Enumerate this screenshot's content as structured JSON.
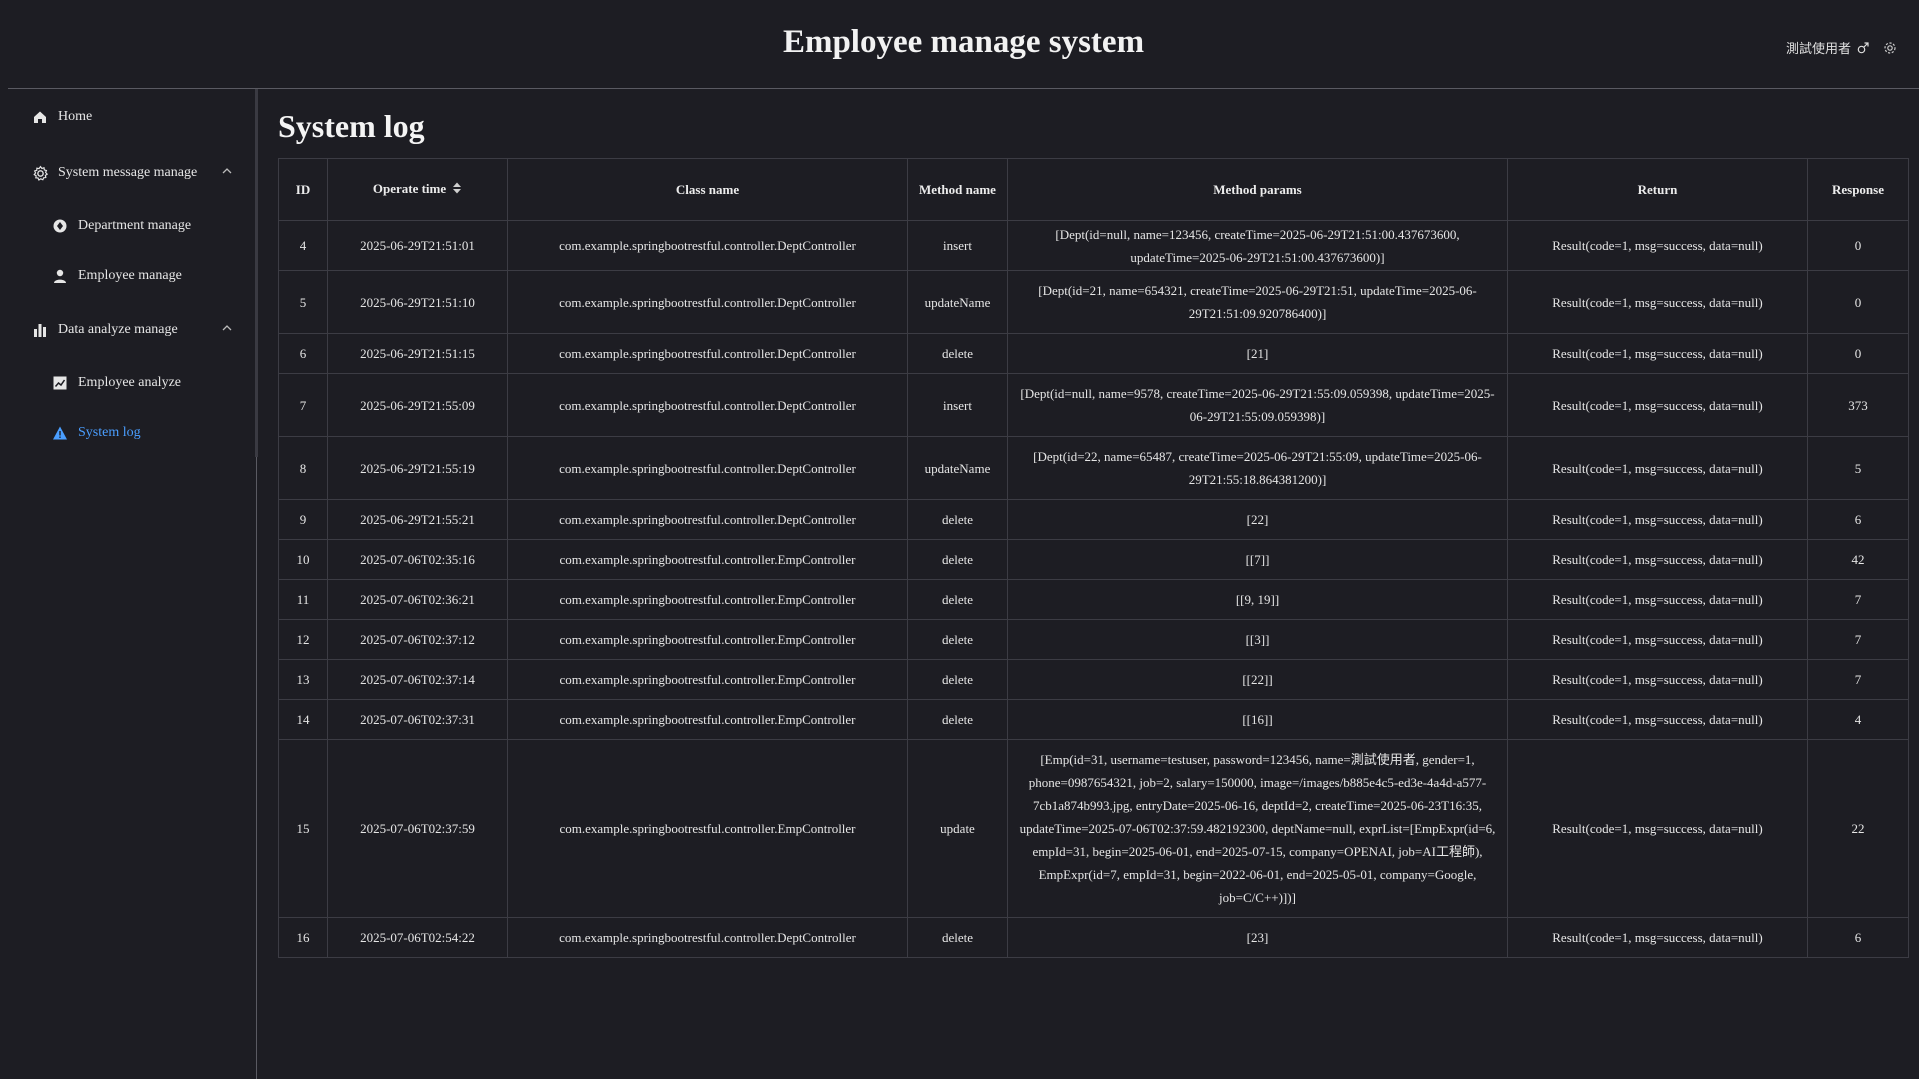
{
  "app": {
    "title": "Employee manage system",
    "user": "測試使用者"
  },
  "sidebar": {
    "items": [
      {
        "label": "Home",
        "icon": "home-icon"
      },
      {
        "label": "System message manage",
        "icon": "gear-icon"
      },
      {
        "label": "Department manage",
        "icon": "department-icon"
      },
      {
        "label": "Employee manage",
        "icon": "user-icon"
      },
      {
        "label": "Data analyze manage",
        "icon": "bar-chart-icon"
      },
      {
        "label": "Employee analyze",
        "icon": "line-chart-icon"
      },
      {
        "label": "System log",
        "icon": "warning-icon"
      }
    ]
  },
  "page": {
    "title": "System log"
  },
  "table": {
    "headers": [
      "ID",
      "Operate time",
      "Class name",
      "Method name",
      "Method params",
      "Return",
      "Response"
    ],
    "rows": [
      {
        "id": "4",
        "time": "2025-06-29T21:51:01",
        "cls": "com.example.springbootrestful.controller.DeptController",
        "method": "insert",
        "params": "[Dept(id=null, name=123456, createTime=2025-06-29T21:51:00.437673600, updateTime=2025-06-29T21:51:00.437673600)]",
        "ret": "Result(code=1, msg=success, data=null)",
        "resp": "0"
      },
      {
        "id": "5",
        "time": "2025-06-29T21:51:10",
        "cls": "com.example.springbootrestful.controller.DeptController",
        "method": "updateName",
        "params": "[Dept(id=21, name=654321, createTime=2025-06-29T21:51, updateTime=2025-06-29T21:51:09.920786400)]",
        "ret": "Result(code=1, msg=success, data=null)",
        "resp": "0"
      },
      {
        "id": "6",
        "time": "2025-06-29T21:51:15",
        "cls": "com.example.springbootrestful.controller.DeptController",
        "method": "delete",
        "params": "[21]",
        "ret": "Result(code=1, msg=success, data=null)",
        "resp": "0"
      },
      {
        "id": "7",
        "time": "2025-06-29T21:55:09",
        "cls": "com.example.springbootrestful.controller.DeptController",
        "method": "insert",
        "params": "[Dept(id=null, name=9578, createTime=2025-06-29T21:55:09.059398, updateTime=2025-06-29T21:55:09.059398)]",
        "ret": "Result(code=1, msg=success, data=null)",
        "resp": "373"
      },
      {
        "id": "8",
        "time": "2025-06-29T21:55:19",
        "cls": "com.example.springbootrestful.controller.DeptController",
        "method": "updateName",
        "params": "[Dept(id=22, name=65487, createTime=2025-06-29T21:55:09, updateTime=2025-06-29T21:55:18.864381200)]",
        "ret": "Result(code=1, msg=success, data=null)",
        "resp": "5"
      },
      {
        "id": "9",
        "time": "2025-06-29T21:55:21",
        "cls": "com.example.springbootrestful.controller.DeptController",
        "method": "delete",
        "params": "[22]",
        "ret": "Result(code=1, msg=success, data=null)",
        "resp": "6"
      },
      {
        "id": "10",
        "time": "2025-07-06T02:35:16",
        "cls": "com.example.springbootrestful.controller.EmpController",
        "method": "delete",
        "params": "[[7]]",
        "ret": "Result(code=1, msg=success, data=null)",
        "resp": "42"
      },
      {
        "id": "11",
        "time": "2025-07-06T02:36:21",
        "cls": "com.example.springbootrestful.controller.EmpController",
        "method": "delete",
        "params": "[[9, 19]]",
        "ret": "Result(code=1, msg=success, data=null)",
        "resp": "7"
      },
      {
        "id": "12",
        "time": "2025-07-06T02:37:12",
        "cls": "com.example.springbootrestful.controller.EmpController",
        "method": "delete",
        "params": "[[3]]",
        "ret": "Result(code=1, msg=success, data=null)",
        "resp": "7"
      },
      {
        "id": "13",
        "time": "2025-07-06T02:37:14",
        "cls": "com.example.springbootrestful.controller.EmpController",
        "method": "delete",
        "params": "[[22]]",
        "ret": "Result(code=1, msg=success, data=null)",
        "resp": "7"
      },
      {
        "id": "14",
        "time": "2025-07-06T02:37:31",
        "cls": "com.example.springbootrestful.controller.EmpController",
        "method": "delete",
        "params": "[[16]]",
        "ret": "Result(code=1, msg=success, data=null)",
        "resp": "4"
      },
      {
        "id": "15",
        "time": "2025-07-06T02:37:59",
        "cls": "com.example.springbootrestful.controller.EmpController",
        "method": "update",
        "params": "[Emp(id=31, username=testuser, password=123456, name=測試使用者, gender=1, phone=0987654321, job=2, salary=150000, image=/images/b885e4c5-ed3e-4a4d-a577-7cb1a874b993.jpg, entryDate=2025-06-16, deptId=2, createTime=2025-06-23T16:35, updateTime=2025-07-06T02:37:59.482192300, deptName=null, exprList=[EmpExpr(id=6, empId=31, begin=2025-06-01, end=2025-07-15, company=OPENAI, job=AI工程師), EmpExpr(id=7, empId=31, begin=2022-06-01, end=2025-05-01, company=Google, job=C/C++)])]",
        "ret": "Result(code=1, msg=success, data=null)",
        "resp": "22"
      },
      {
        "id": "16",
        "time": "2025-07-06T02:54:22",
        "cls": "com.example.springbootrestful.controller.DeptController",
        "method": "delete",
        "params": "[23]",
        "ret": "Result(code=1, msg=success, data=null)",
        "resp": "6"
      }
    ]
  }
}
